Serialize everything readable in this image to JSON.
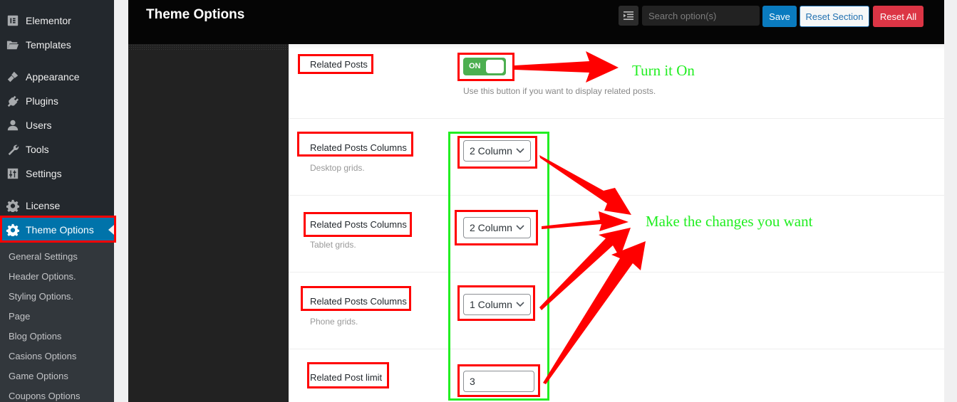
{
  "sidebar": {
    "items": [
      {
        "label": "Elementor",
        "icon": "elementor-icon"
      },
      {
        "label": "Templates",
        "icon": "folder-icon"
      },
      {
        "label": "Appearance",
        "icon": "paintbrush-icon"
      },
      {
        "label": "Plugins",
        "icon": "plugin-icon"
      },
      {
        "label": "Users",
        "icon": "user-icon"
      },
      {
        "label": "Tools",
        "icon": "wrench-icon"
      },
      {
        "label": "Settings",
        "icon": "settings-sliders-icon"
      },
      {
        "label": "License",
        "icon": "gear-icon"
      },
      {
        "label": "Theme Options",
        "icon": "gear-icon",
        "active": true
      }
    ],
    "submenu": [
      "General Settings",
      "Header Options.",
      "Styling Options.",
      "Page",
      "Blog Options",
      "Casions Options",
      "Game Options",
      "Coupons Options"
    ]
  },
  "header": {
    "title": "Theme Options",
    "search_placeholder": "Search option(s)",
    "save_label": "Save",
    "reset_section_label": "Reset Section",
    "reset_all_label": "Reset All"
  },
  "options": [
    {
      "label": "Related Posts",
      "type": "toggle",
      "value": "ON",
      "field_desc": "Use this button if you want to display related posts."
    },
    {
      "label": "Related Posts Columns",
      "desc": "Desktop grids.",
      "type": "select",
      "value": "2 Column"
    },
    {
      "label": "Related Posts Columns",
      "desc": "Tablet grids.",
      "type": "select",
      "value": "2 Column"
    },
    {
      "label": "Related Posts Columns",
      "desc": "Phone grids.",
      "type": "select",
      "value": "1 Column"
    },
    {
      "label": "Related Post limit",
      "type": "number",
      "value": "3"
    }
  ],
  "annotations": {
    "turn_on": "Turn it On",
    "make_changes": "Make the changes you want",
    "colors": {
      "red": "#ff0000",
      "green": "#22ee22"
    }
  },
  "colors": {
    "sidebar_bg": "#23282d",
    "active_menu": "#0073aa",
    "save": "#0a7bbf",
    "reset_all": "#dc3545",
    "toggle_on": "#4caf50"
  }
}
